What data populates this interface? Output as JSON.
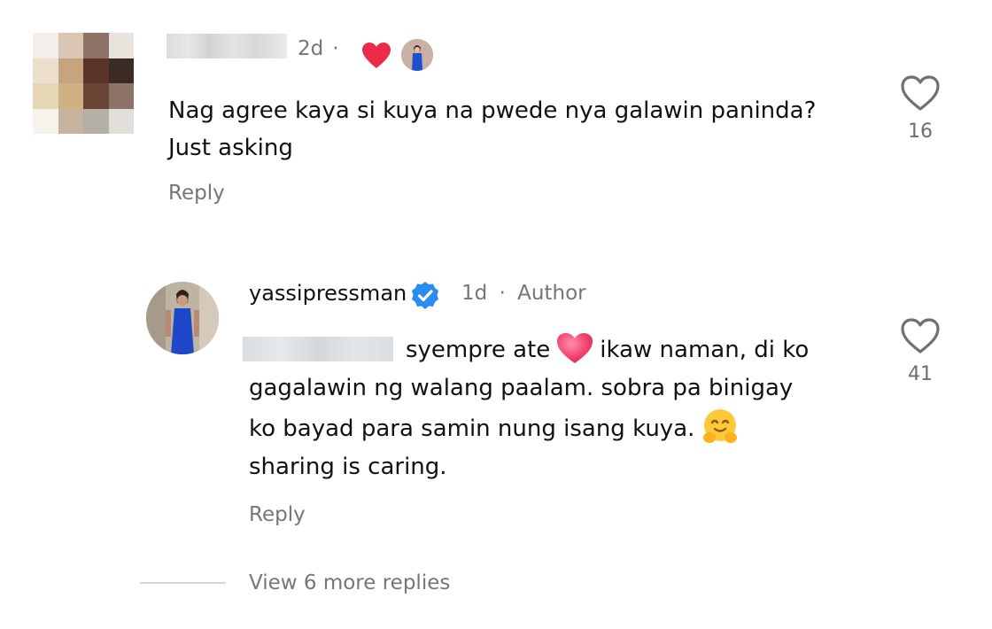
{
  "comment": {
    "time": "2d",
    "separator": "·",
    "text_line1": "Nag agree kaya si kuya na pwede nya galawin paninda?",
    "text_line2": "Just asking",
    "like_count": "16",
    "reply_label": "Reply",
    "icons": {
      "creator_liked": "red-heart-icon",
      "creator_avatar": "creator-mini-avatar"
    }
  },
  "reply": {
    "username": "yassipressman",
    "verified_icon": "verified-badge-icon",
    "time": "1d",
    "separator": "·",
    "author_label": "Author",
    "text_part1": "syempre ate",
    "text_part2": "ikaw naman, di ko",
    "text_line2": "gagalawin ng walang paalam. sobra pa binigay",
    "text_line3": "ko bayad para samin nung isang kuya.",
    "text_line4": "sharing is caring.",
    "emojis": [
      "pink-heart-icon",
      "hugging-face-icon"
    ],
    "like_count": "41",
    "reply_label": "Reply"
  },
  "thread": {
    "view_more_label": "View 6 more replies"
  },
  "colors": {
    "text_primary": "#111111",
    "text_secondary": "#767676",
    "heart_red": "#ee2a4a",
    "verified_blue": "#2a8cf0"
  }
}
